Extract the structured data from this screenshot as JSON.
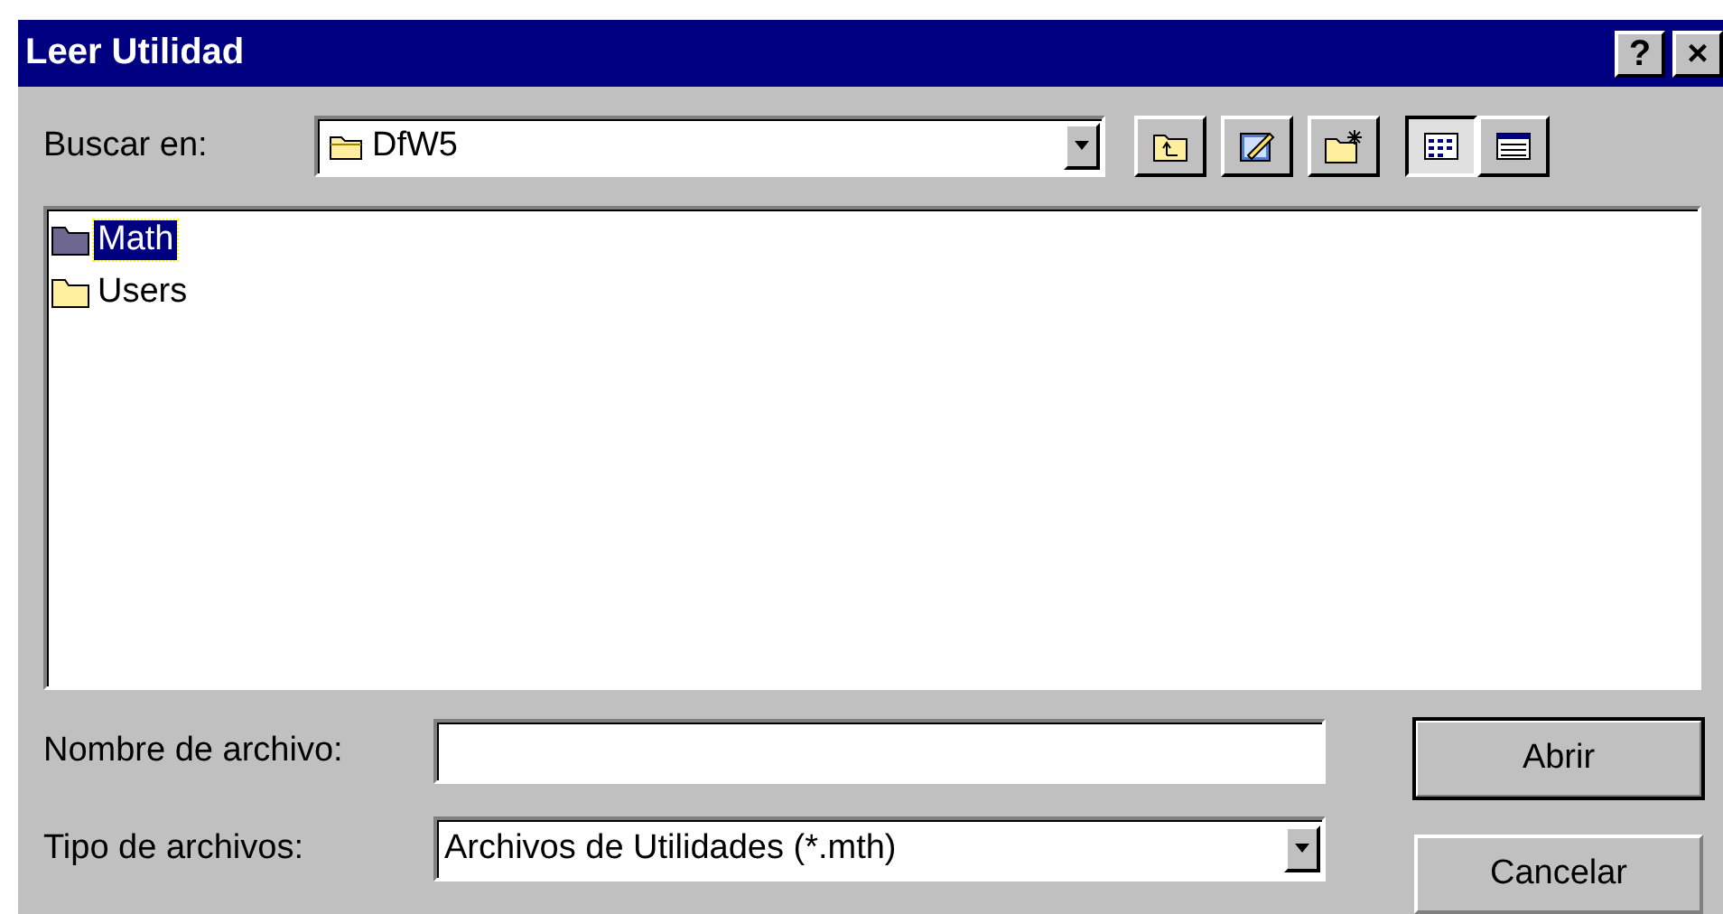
{
  "window": {
    "title": "Leer Utilidad",
    "controls": [
      "?",
      "×"
    ]
  },
  "look_in": {
    "label": "Buscar en:",
    "value": "DfW5"
  },
  "toolbar": [
    {
      "kind": "up",
      "selected": false
    },
    {
      "kind": "edit",
      "selected": false
    },
    {
      "kind": "newfolder",
      "selected": false
    },
    {
      "kind": "list",
      "selected": true
    },
    {
      "kind": "details",
      "selected": false
    }
  ],
  "files": [
    {
      "name": "Math",
      "selected": true
    },
    {
      "name": "Users",
      "selected": false
    }
  ],
  "file_name": {
    "label": "Nombre de archivo:"
  },
  "file_type": {
    "label": "Tipo de archivos:",
    "value": "Archivos de Utilidades (*.mth)"
  },
  "buttons": [
    {
      "label": "Abrir",
      "default": true
    },
    {
      "label": "Cancelar",
      "default": false
    }
  ]
}
